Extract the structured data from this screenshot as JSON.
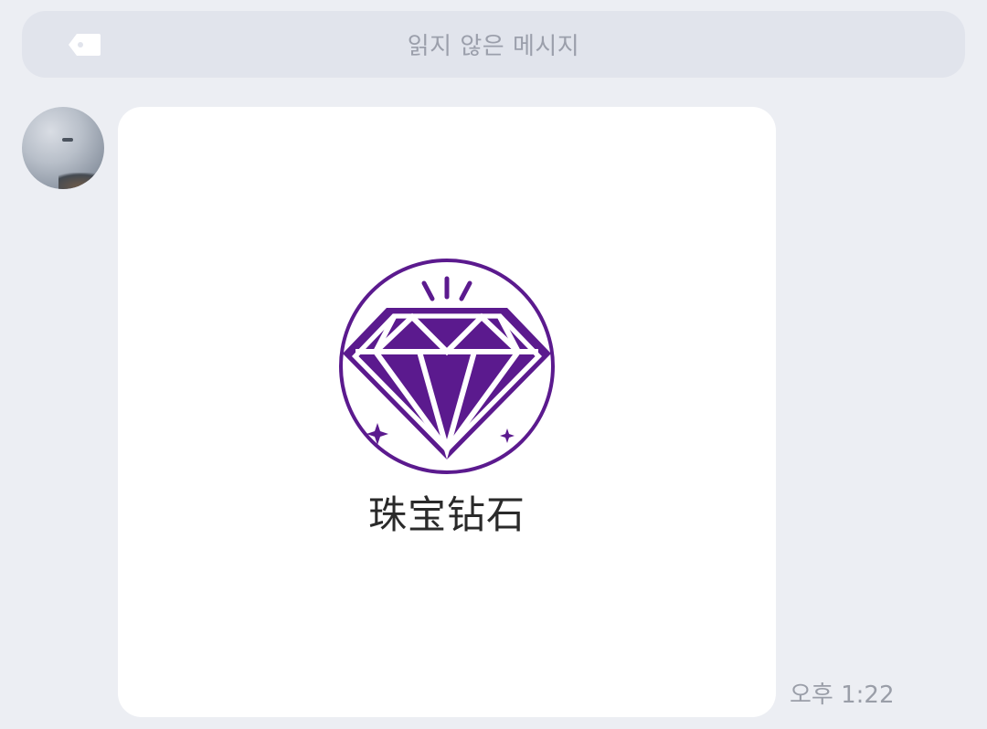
{
  "banner": {
    "icon": "tag-icon",
    "text": "읽지 않은 메시지"
  },
  "message": {
    "avatar": "avatar",
    "image": {
      "icon": "diamond-icon",
      "caption": "珠宝钻石",
      "accent_color": "#5b1a8e"
    },
    "time": "오후 1:22"
  }
}
